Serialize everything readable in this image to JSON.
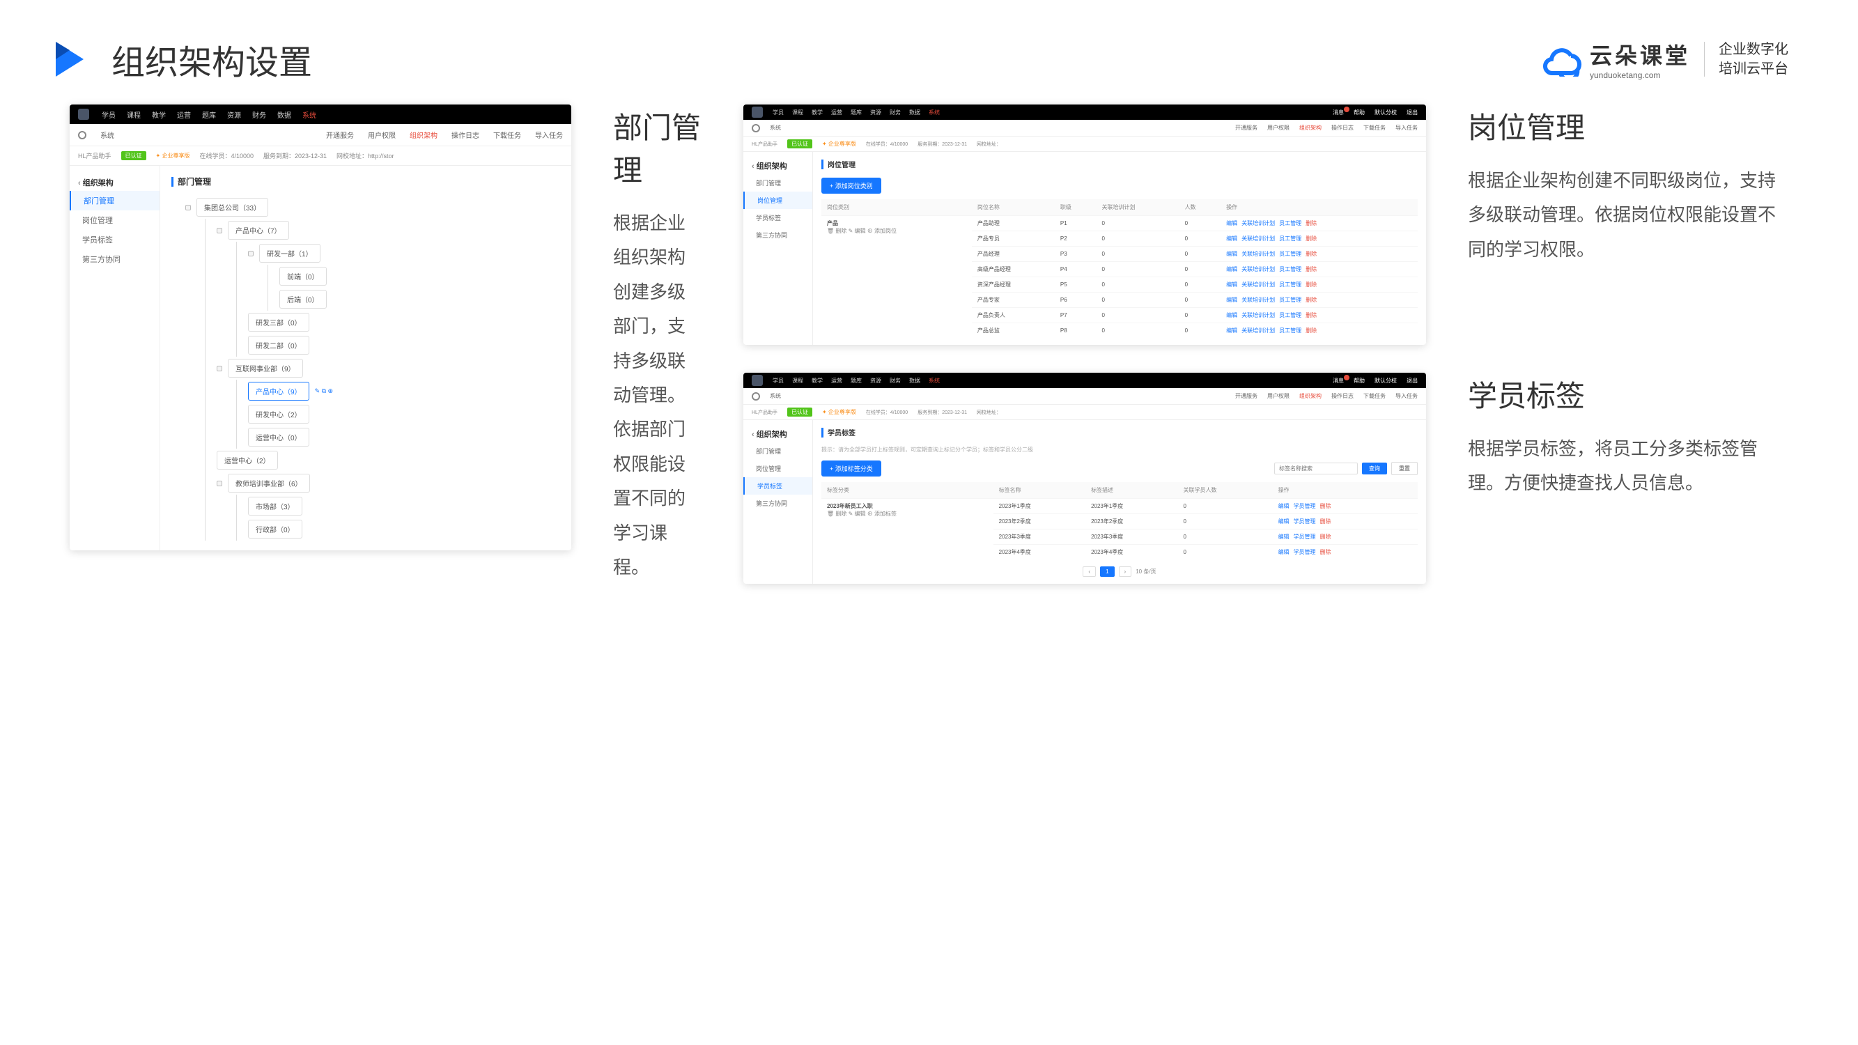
{
  "page_title": "组织架构设置",
  "brand": {
    "name": "云朵课堂",
    "url": "yunduoketang.com",
    "tagline": "企业数字化\n培训云平台"
  },
  "topnav": [
    "学员",
    "课程",
    "教学",
    "运营",
    "题库",
    "资源",
    "财务",
    "数据",
    "系统"
  ],
  "topnav_active": "系统",
  "subnav": {
    "sys": "系统",
    "items": [
      "开通服务",
      "用户权限",
      "组织架构",
      "操作日志",
      "下载任务",
      "导入任务"
    ],
    "active": "组织架构"
  },
  "info": {
    "org": "HL产品助手",
    "verified": "已认证",
    "plan": "企业尊享版",
    "online": "在线学员：4/10000",
    "expire": "服务到期：2023-12-31",
    "url": "网校地址：http://stor"
  },
  "info2_url": "网校地址：",
  "sidebar": {
    "title": "组织架构",
    "items": [
      "部门管理",
      "岗位管理",
      "学员标签",
      "第三方协同"
    ]
  },
  "shot1": {
    "section": "部门管理",
    "tree": {
      "root": "集团总公司（33）",
      "pc": "产品中心（7）",
      "rd1": "研发一部（1）",
      "fe": "前端（0）",
      "be": "后端（0）",
      "rd3": "研发三部（0）",
      "rd2": "研发二部（0）",
      "net": "互联网事业部（9）",
      "pc2": "产品中心（9）",
      "rdc": "研发中心（2）",
      "opc": "运营中心（0）",
      "op": "运营中心（2）",
      "edu": "教师培训事业部（6）",
      "mkt": "市场部（3）",
      "adm": "行政部（0）"
    }
  },
  "desc1": {
    "title": "部门管理",
    "text": "根据企业组织架构创建多级部门，支持多级联动管理。依据部门权限能设置不同的学习课程。"
  },
  "shot2": {
    "section": "岗位管理",
    "add_btn": "添加岗位类别",
    "headers": [
      "岗位类别",
      "岗位名称",
      "职级",
      "关联培训计划",
      "人数",
      "操作"
    ],
    "cat": "产品",
    "cat_ops": [
      "删除",
      "编辑",
      "添加岗位"
    ],
    "rows": [
      {
        "n": "产品助理",
        "l": "P1",
        "t": "0",
        "p": "0"
      },
      {
        "n": "产品专员",
        "l": "P2",
        "t": "0",
        "p": "0"
      },
      {
        "n": "产品经理",
        "l": "P3",
        "t": "0",
        "p": "0"
      },
      {
        "n": "高级产品经理",
        "l": "P4",
        "t": "0",
        "p": "0"
      },
      {
        "n": "资深产品经理",
        "l": "P5",
        "t": "0",
        "p": "0"
      },
      {
        "n": "产品专家",
        "l": "P6",
        "t": "0",
        "p": "0"
      },
      {
        "n": "产品负责人",
        "l": "P7",
        "t": "0",
        "p": "0"
      },
      {
        "n": "产品总监",
        "l": "P8",
        "t": "0",
        "p": "0"
      }
    ],
    "ops": [
      "编辑",
      "关联培训计划",
      "员工管理",
      "删除"
    ]
  },
  "desc2": {
    "title": "岗位管理",
    "text": "根据企业架构创建不同职级岗位，支持多级联动管理。依据岗位权限能设置不同的学习权限。"
  },
  "shot3": {
    "section": "学员标签",
    "hint": "提示：请为全部学员打上标签规则，可定期查询上标记分个学员；标签和学员公分二级",
    "add_btn": "添加标签分类",
    "search_ph": "标签名称搜索",
    "search_btn": "查询",
    "reset_btn": "重置",
    "headers": [
      "标签分类",
      "标签名称",
      "标签描述",
      "关联学员人数",
      "操作"
    ],
    "cat": "2023年新员工入职",
    "cat_ops": [
      "删除",
      "编辑",
      "添加标签"
    ],
    "rows": [
      {
        "n": "2023年1季度",
        "d": "2023年1季度",
        "p": "0"
      },
      {
        "n": "2023年2季度",
        "d": "2023年2季度",
        "p": "0"
      },
      {
        "n": "2023年3季度",
        "d": "2023年3季度",
        "p": "0"
      },
      {
        "n": "2023年4季度",
        "d": "2023年4季度",
        "p": "0"
      }
    ],
    "ops": [
      "编辑",
      "学员管理",
      "删除"
    ],
    "pager": {
      "cur": "1",
      "next": "›",
      "size": "10 条/页"
    }
  },
  "desc3": {
    "title": "学员标签",
    "text": "根据学员标签，将员工分多类标签管理。方便快捷查找人员信息。"
  },
  "topbar_r": {
    "msg": "消息",
    "help": "帮助",
    "branch": "默认分校",
    "exit": "退出"
  }
}
